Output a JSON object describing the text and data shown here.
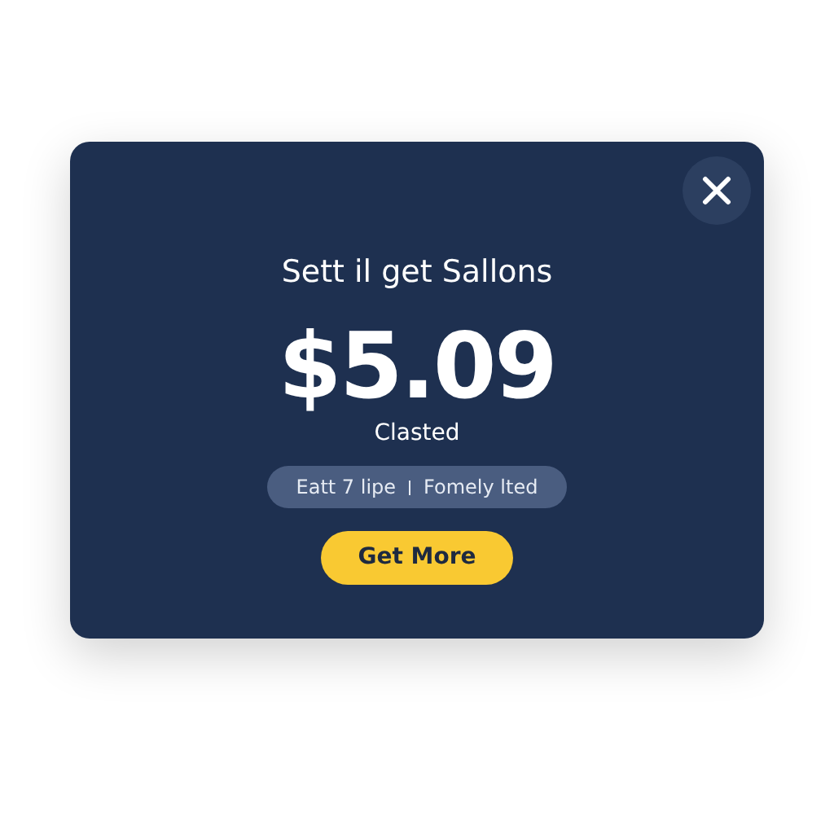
{
  "dialog": {
    "title": "Sett il get Sallons",
    "price": "$5.09",
    "caption": "Clasted",
    "pill": [
      "Eatt 7 lipe",
      "Fomely lted"
    ],
    "button": "Get More"
  }
}
